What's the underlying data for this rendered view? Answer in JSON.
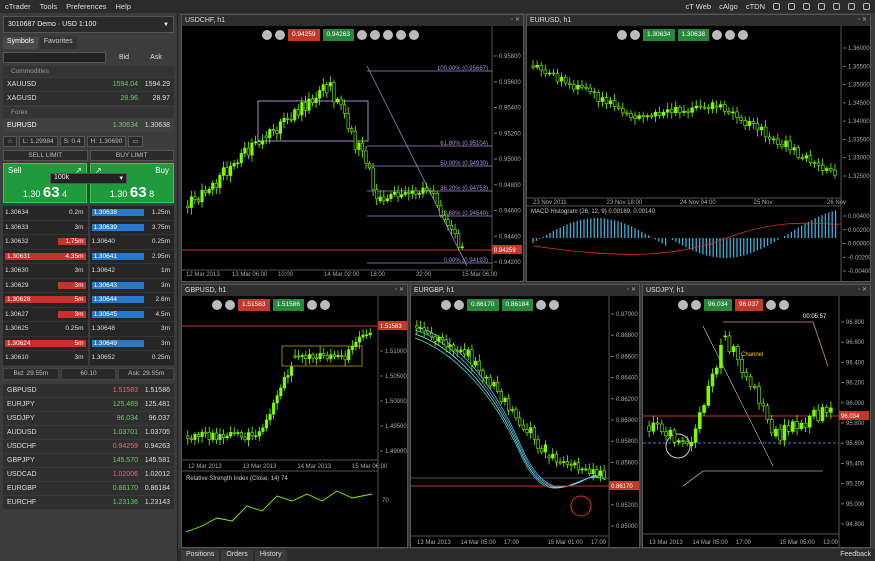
{
  "menu": {
    "app": "cTrader",
    "items": [
      "Tools",
      "Preferences",
      "Help"
    ],
    "right": [
      "cT Web",
      "cAlgo",
      "cTDN"
    ]
  },
  "account": {
    "label": "3010687  Demo · USD  1:100"
  },
  "tabs": [
    "Symbols",
    "Favorites"
  ],
  "symbols_header": {
    "bid": "Bid",
    "ask": "Ask",
    "search_placeholder": ""
  },
  "sections": {
    "commodities": "Commodities",
    "forex": "Forex"
  },
  "commodities": [
    {
      "sym": "XAUUSD",
      "bid": "1594.04",
      "ask": "1594.29"
    },
    {
      "sym": "XAGUSD",
      "bid": "28.96",
      "ask": "28.97"
    }
  ],
  "selected": {
    "sym": "EURUSD",
    "bid": "1.30634",
    "ask": "1.30638",
    "low": "L: 1.29984",
    "spread": "S: 0.4",
    "high": "H: 1.30690",
    "sell_limit": "SELL LIMIT",
    "buy_limit": "BUY LIMIT",
    "sell": "Sell",
    "buy": "Buy",
    "qty": "100k",
    "sell_px_a": "1.30",
    "sell_px_b": "63",
    "sell_px_c": "4",
    "buy_px_a": "1.30",
    "buy_px_b": "63",
    "buy_px_c": "8"
  },
  "dom_bid": [
    {
      "p": "1.30634",
      "v": "0.2m",
      "vr": false
    },
    {
      "p": "1.30633",
      "v": "3m",
      "vr": false
    },
    {
      "p": "1.30632",
      "v": "1.75m",
      "vr": true
    },
    {
      "p": "1.30631",
      "v": "4.35m",
      "vr": true,
      "pr": true
    },
    {
      "p": "1.30630",
      "v": "3m",
      "vr": false
    },
    {
      "p": "1.30629",
      "v": "3m",
      "vr": true
    },
    {
      "p": "1.30628",
      "v": "5m",
      "vr": true,
      "pr": true
    },
    {
      "p": "1.30627",
      "v": "3m",
      "vr": true
    },
    {
      "p": "1.30625",
      "v": "0.25m",
      "vr": false
    },
    {
      "p": "1.30624",
      "v": "5m",
      "vr": true,
      "pr": true
    },
    {
      "p": "1.30610",
      "v": "3m",
      "vr": false
    }
  ],
  "dom_ask": [
    {
      "p": "1.30638",
      "v": "1.25m",
      "pb": true
    },
    {
      "p": "1.30639",
      "v": "3.75m",
      "pb": true
    },
    {
      "p": "1.30640",
      "v": "0.25m",
      "pb": false
    },
    {
      "p": "1.30641",
      "v": "2.95m",
      "pb": true
    },
    {
      "p": "1.30642",
      "v": "1m",
      "pb": false
    },
    {
      "p": "1.30643",
      "v": "3m",
      "pb": true
    },
    {
      "p": "1.30644",
      "v": "2.6m",
      "pb": true
    },
    {
      "p": "1.30645",
      "v": "4.5m",
      "pb": true
    },
    {
      "p": "1.30648",
      "v": "3m",
      "pb": false
    },
    {
      "p": "1.30649",
      "v": "3m",
      "pb": true
    },
    {
      "p": "1.30652",
      "v": "0.25m",
      "pb": false
    }
  ],
  "spread_row": [
    "Bid: 29.55m",
    "60.10",
    "Ask: 29.55m"
  ],
  "forex": [
    {
      "sym": "GBPUSD",
      "bid": "1.51583",
      "ask": "1.51586",
      "c": "r"
    },
    {
      "sym": "EURJPY",
      "bid": "125.469",
      "ask": "125.481",
      "c": "g"
    },
    {
      "sym": "USDJPY",
      "bid": "96.034",
      "ask": "96.037",
      "c": "g"
    },
    {
      "sym": "AUDUSD",
      "bid": "1.03701",
      "ask": "1.03705",
      "c": "g"
    },
    {
      "sym": "USDCHF",
      "bid": "0.94259",
      "ask": "0.94263",
      "c": "r"
    },
    {
      "sym": "GBPJPY",
      "bid": "145.570",
      "ask": "145.581",
      "c": "g"
    },
    {
      "sym": "USDCAD",
      "bid": "1.02006",
      "ask": "1.02012",
      "c": "r"
    },
    {
      "sym": "EURGBP",
      "bid": "0.86170",
      "ask": "0.86184",
      "c": "g"
    },
    {
      "sym": "EURCHF",
      "bid": "1.23136",
      "ask": "1.23143",
      "c": "g"
    }
  ],
  "bottom_tabs": [
    "Positions",
    "Orders",
    "History"
  ],
  "feedback": "Feedback",
  "charts": {
    "usdchf": {
      "title": "USDCHF, h1",
      "sell": "0.94259",
      "buy": "0.94263",
      "last": "0.94259",
      "fib": [
        "100.00% (0.95667)",
        "61.80% (0.95104)",
        "50.00% (0.94930)",
        "38.20% (0.94753)",
        "23.60% (0.94540)",
        "0.00% (0.94193)"
      ],
      "y": [
        "0.95800",
        "0.95600",
        "0.95400",
        "0.95200",
        "0.95000",
        "0.94800",
        "0.94600",
        "0.94400",
        "0.94200"
      ],
      "x": [
        "12 Mar 2013",
        "13 Mar 06:00",
        "10:00",
        "14 Mar 02:00",
        "18:00",
        "22:00",
        "15 Mar 06:00"
      ]
    },
    "eurusd": {
      "title": "EURUSD, h1",
      "sell": "1.30634",
      "buy": "1.30638",
      "y": [
        "1.36000",
        "1.35500",
        "1.35000",
        "1.34500",
        "1.34000",
        "1.33500",
        "1.33000",
        "1.32500"
      ],
      "x": [
        "23 Nov 2011",
        "23 Nov 18:00",
        "24 Nov 04:00",
        "25 Nov",
        "26 Nov"
      ],
      "macd": "MACD Histogram (26, 12, 9) 0.00189, 0.00140",
      "macd_y": [
        "0.00400",
        "0.00200",
        "0.00000",
        "-0.00200",
        "-0.00400"
      ]
    },
    "gbpusd": {
      "title": "GBPUSD, h1",
      "sell": "1.51583",
      "buy": "1.51586",
      "last": "1.51583",
      "y": [
        "1.51500",
        "1.51000",
        "1.50500",
        "1.50000",
        "1.49500",
        "1.49000"
      ],
      "x": [
        "12 Mar 2013",
        "13 Mar 2013",
        "14 Mar 2013",
        "15 Mar 06:00"
      ],
      "rsi": "Relative Strength Index (Close, 14) 74",
      "rsi_y": [
        "70",
        "30"
      ]
    },
    "eurgbp": {
      "title": "EURGBP, h1",
      "sell": "0.86170",
      "buy": "0.86184",
      "last": "0.86170",
      "y": [
        "0.87000",
        "0.86800",
        "0.86600",
        "0.86400",
        "0.86200",
        "0.86000",
        "0.85800",
        "0.85600",
        "0.85400",
        "0.85200",
        "0.85000"
      ],
      "x": [
        "13 Mar 2013",
        "14 Mar 05:00",
        "17:00",
        "15 Mar 01:00",
        "17:00"
      ]
    },
    "usdjpy": {
      "title": "USDJPY, h1",
      "sell": "96.034",
      "buy": "96.037",
      "last": "96.034",
      "timer": "00:05:57",
      "label": "Channel",
      "y": [
        "96.800",
        "96.600",
        "96.400",
        "96.200",
        "96.000",
        "95.800",
        "95.600",
        "95.400",
        "95.200",
        "95.000",
        "94.800"
      ],
      "x": [
        "13 Mar 2013",
        "14 Mar 05:00",
        "17:00",
        "15 Mar 05:00",
        "13:00"
      ]
    }
  },
  "colors": {
    "green": "#27883a",
    "red": "#c0392b",
    "candle": "#7cfc00"
  }
}
